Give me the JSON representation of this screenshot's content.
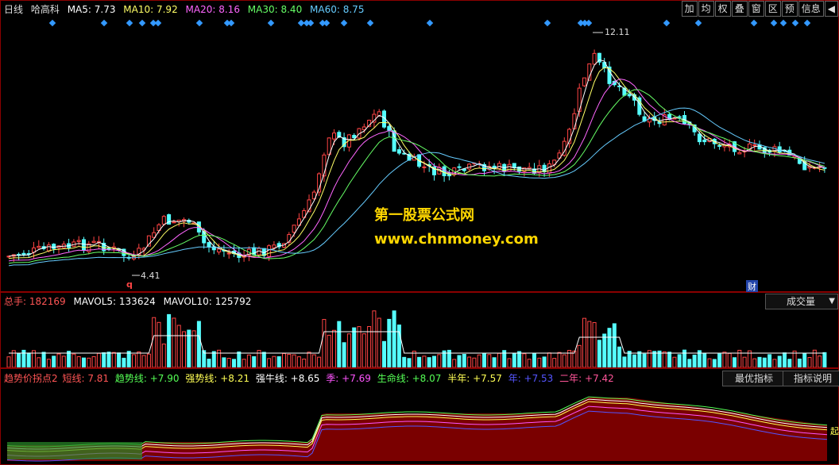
{
  "main": {
    "period": "日线",
    "stock_name": "哈高科",
    "ma": [
      {
        "label": "MA5: 7.73",
        "color": "#ffffff"
      },
      {
        "label": "MA10: 7.92",
        "color": "#ffff66"
      },
      {
        "label": "MA20: 8.16",
        "color": "#ff66ff"
      },
      {
        "label": "MA30: 8.40",
        "color": "#66ff66"
      },
      {
        "label": "MA60: 8.75",
        "color": "#66ccff"
      }
    ],
    "high_label": "12.11",
    "low_label": "4.41",
    "q_marker": "q",
    "cai_marker": "财",
    "watermark_cn": "第一股票公式网",
    "watermark_url": "www.chnmoney.com"
  },
  "toolbar": [
    "加",
    "均",
    "权",
    "叠",
    "窗",
    "区",
    "预",
    "信息",
    "◀"
  ],
  "volume": {
    "total_label": "总手: 182169",
    "mavol5": "MAVOL5: 133624",
    "mavol10": "MAVOL10: 125792",
    "selector": "成交量",
    "selector_arrow": "▼"
  },
  "indicator": {
    "name": "趋势价拐点2",
    "items": [
      {
        "label": "短线: 7.81",
        "color": "#ff5555"
      },
      {
        "label": "趋势线: +7.90",
        "color": "#55ff55"
      },
      {
        "label": "强势线: +8.21",
        "color": "#ffff55"
      },
      {
        "label": "强牛线: +8.65",
        "color": "#ffffff"
      },
      {
        "label": "季: +7.69",
        "color": "#ff55ff"
      },
      {
        "label": "生命线: +8.07",
        "color": "#55ff55"
      },
      {
        "label": "半年: +7.57",
        "color": "#ffff55"
      },
      {
        "label": "年: +7.53",
        "color": "#5555ff"
      },
      {
        "label": "二年: +7.42",
        "color": "#ff5599"
      }
    ],
    "btn_best": "最优指标",
    "btn_explain": "指标说明",
    "side_mark": "起"
  }
}
